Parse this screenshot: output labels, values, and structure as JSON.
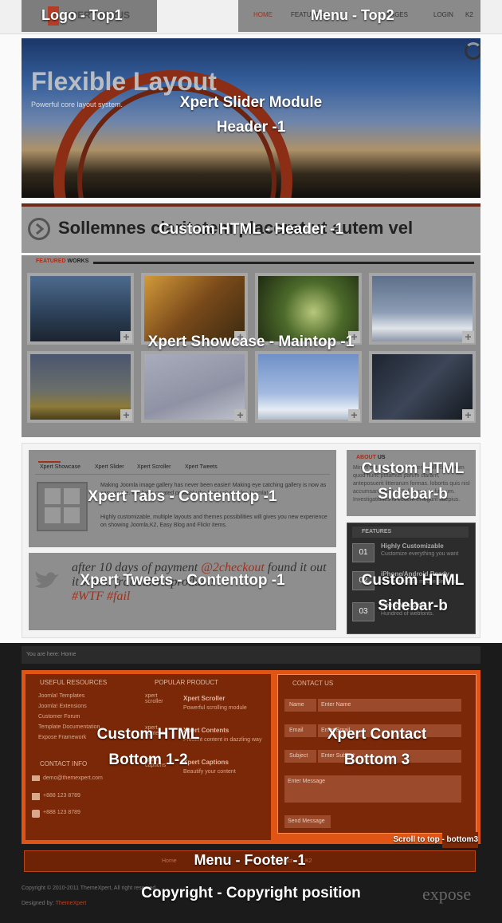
{
  "top": {
    "logo_text": "XPERT MIRUS",
    "menu_items": [
      "HOME",
      "FEATURES",
      "PAGES",
      "LOGIN",
      "K2"
    ],
    "overlay_logo": "Logo - Top1",
    "overlay_menu": "Menu - Top2"
  },
  "slider": {
    "title": "Flexible Layout",
    "subtitle": "Powerful core layout system.",
    "overlay_line1": "Xpert Slider Module",
    "overlay_line2": "Header -1"
  },
  "custom_header": {
    "text": "Sollemnes claritatem placerat ut autem vel",
    "overlay": "Custom HTML - Header -1"
  },
  "showcase": {
    "label_accent": "FEATURED",
    "label_rest": "WORKS",
    "overlay": "Xpert Showcase - Maintop -1",
    "plus_symbol": "+"
  },
  "tabs": {
    "items": [
      "Xpert Showcase",
      "Xpert Slider",
      "Xpert Scroller",
      "Xpert Tweets"
    ],
    "para1": "Making Joomla image gallery has never been easier! Making eye catching gallery is now as easy as pie. We have created probably the best solution for Joomla!",
    "para2": "Highly customizable, multiple layouts and themes possibilities will gives you new experience on showing Joomla,K2, Easy Blog and Flickr items.",
    "overlay": "Xpert Tabs - Contenttop -1"
  },
  "tweets": {
    "text_prefix": "after 10 days of payment ",
    "mention": "@2checkout",
    "text_mid": " found it out it was a fraudulent product!",
    "hashtags": "#WTF #fail",
    "overlay": "Xpert Tweets - Contenttop -1"
  },
  "about": {
    "heading_accent": "ABOUT",
    "heading_rest": "US",
    "text": "Mirum est notare quam littera gothica. Forum quod nunc putamus parum claram, anteposuerit litterarum formas. lobortis quis nisl accumsan spectur. Sollemnes in futurum. Investigationes id eodem et legunt saepius.",
    "overlay_line1": "Custom HTML",
    "overlay_line2": "Sidebar-b"
  },
  "features": {
    "heading": "FEATURES",
    "items": [
      {
        "num": "01",
        "title": "Highly Customizable",
        "sub": "Customize everything you want"
      },
      {
        "num": "02",
        "title": "iPhone/Android Ready",
        "sub": "Looks great on mobile devices"
      },
      {
        "num": "03",
        "title": "Xpert Modules",
        "sub": "Hundred of webfonts."
      }
    ],
    "overlay_line1": "Custom HTML",
    "overlay_line2": "Sidebar-b"
  },
  "footer": {
    "breadcrumb_prefix": "You are here:",
    "breadcrumb_home": "Home",
    "useful_heading": "USEFUL RESOURCES",
    "useful_links": [
      "Joomla! Templates",
      "Joomla! Extensions",
      "Customer Forum",
      "Template Documentation",
      "Expose Framework"
    ],
    "popular_heading": "POPULAR PRODUCT",
    "popular_items": [
      {
        "label": "xpert scroller",
        "title": "Xpert Scroller",
        "sub": "Powerful scrolling module"
      },
      {
        "label": "xpert contents",
        "title": "Xpert Contents",
        "sub": "Present content in dazzling way"
      },
      {
        "label": "xpert captions",
        "title": "Xpert Captions",
        "sub": "Beautify your content"
      }
    ],
    "contact_info_heading": "CONTACT INFO",
    "contact_email": "demo@themexpert.com",
    "contact_phone": "+888 123 8789",
    "contact_fax": "+888 123 8789",
    "contact_heading": "CONTACT US",
    "form": {
      "name_label": "Name",
      "name_placeholder": "Enter Name",
      "email_label": "Email",
      "email_placeholder": "Enter Email",
      "subject_label": "Subject",
      "subject_placeholder": "Enter Subject",
      "message_placeholder": "Enter Message",
      "send_label": "Send Message"
    },
    "overlay_b12_line1": "Custom HTML",
    "overlay_b12_line2": "Bottom 1-2",
    "overlay_b3_line1": "Xpert Contact",
    "overlay_b3_line2": "Bottom 3",
    "scroll_to_top": "Scroll to top - bottom3",
    "footer_menu": [
      "Home",
      "Contact",
      "K2"
    ],
    "overlay_footer_menu": "Menu - Footer -1",
    "copyright": "Copyright © 2010-2011 ThemeXpert, All right reserved.",
    "designed_by_label": "Designed by:",
    "designed_by_name": "ThemeXpert",
    "powered_logo": "expose",
    "overlay_copyright": "Copyright - Copyright position"
  }
}
